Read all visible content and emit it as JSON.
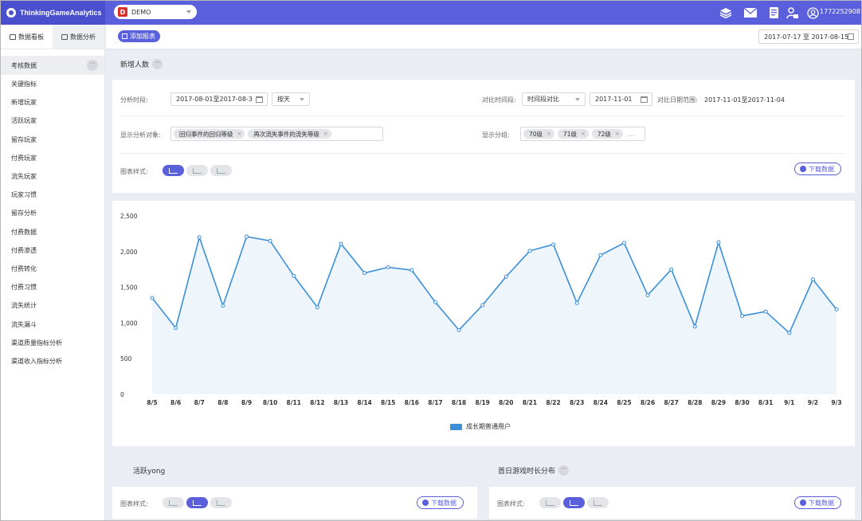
{
  "topbar": {
    "app_name": "ThinkingGameAnalytics",
    "project_badge": "D",
    "project_name": "DEMO",
    "user_id": "17722529087",
    "icons": [
      "layers-icon",
      "mail-icon",
      "book-icon",
      "user-switch-icon",
      "account-icon"
    ]
  },
  "sidebar": {
    "tabs": [
      {
        "label": "数据看板",
        "icon": "dashboard-icon",
        "active": true
      },
      {
        "label": "数据分析",
        "icon": "analysis-icon",
        "active": false
      }
    ],
    "group_header": "考核数据",
    "group_more": "···",
    "items": [
      "关键指标",
      "新增玩家",
      "活跃玩家",
      "留存玩家",
      "付费玩家",
      "流失玩家",
      "玩家习惯",
      "留存分析",
      "付费数据",
      "付费渗透",
      "付费转化",
      "付费习惯",
      "流失统计",
      "流失漏斗",
      "渠道质量指标分析",
      "渠道收入指标分析"
    ]
  },
  "toolbar": {
    "add_report": "添加报表",
    "date_range": "2017-07-17 至 2017-08-15"
  },
  "section": {
    "title": "新增人数",
    "more": "···"
  },
  "filters": {
    "period_label": "分析时段:",
    "period_value": "2017-08-01至2017-08-3",
    "granularity": "按天",
    "compare_label": "对比时间段:",
    "compare_mode": "时间段对比",
    "compare_start": "2017-11-01",
    "compare_range_label": "对比日期范围:",
    "compare_range_value": "2017-11-01至2017-11-04",
    "target_label": "显示分析对象:",
    "targets": [
      "回归事件的回归等级",
      "再次流失事件的流失等级"
    ],
    "group_label": "显示分组:",
    "groups": [
      "70级",
      "71级",
      "72级"
    ],
    "group_more": "...",
    "chart_style_label": "图表样式:",
    "download": "下载数据"
  },
  "chart_data": {
    "type": "line",
    "categories": [
      "8/5",
      "8/6",
      "8/7",
      "8/8",
      "8/9",
      "8/10",
      "8/11",
      "8/12",
      "8/13",
      "8/14",
      "8/15",
      "8/16",
      "8/17",
      "8/18",
      "8/19",
      "8/20",
      "8/21",
      "8/22",
      "8/23",
      "8/24",
      "8/25",
      "8/26",
      "8/27",
      "8/28",
      "8/29",
      "8/30",
      "8/31",
      "9/1",
      "9/2",
      "9/3"
    ],
    "series": [
      {
        "name": "成长期普通用户",
        "values": [
          1350,
          930,
          2200,
          1240,
          2210,
          2150,
          1660,
          1220,
          2110,
          1700,
          1780,
          1740,
          1290,
          900,
          1250,
          1650,
          2010,
          2100,
          1280,
          1950,
          2120,
          1390,
          1750,
          950,
          2130,
          1100,
          1160,
          860,
          1610,
          1190
        ]
      }
    ],
    "yticks": [
      "0",
      "500",
      "1,000",
      "1,500",
      "2,000",
      "2,500"
    ],
    "ylim": [
      0,
      2500
    ],
    "legend": "bottom-center",
    "color": "#3b8fd9",
    "fill": "#eef5fb",
    "grid": false
  },
  "subpanels": [
    {
      "title": "活跃yong",
      "has_more": false,
      "style_label": "图表样式:",
      "download": "下载数据"
    },
    {
      "title": "首日游戏时长分布",
      "has_more": true,
      "more": "···",
      "style_label": "图表样式:",
      "download": "下载数据"
    }
  ]
}
